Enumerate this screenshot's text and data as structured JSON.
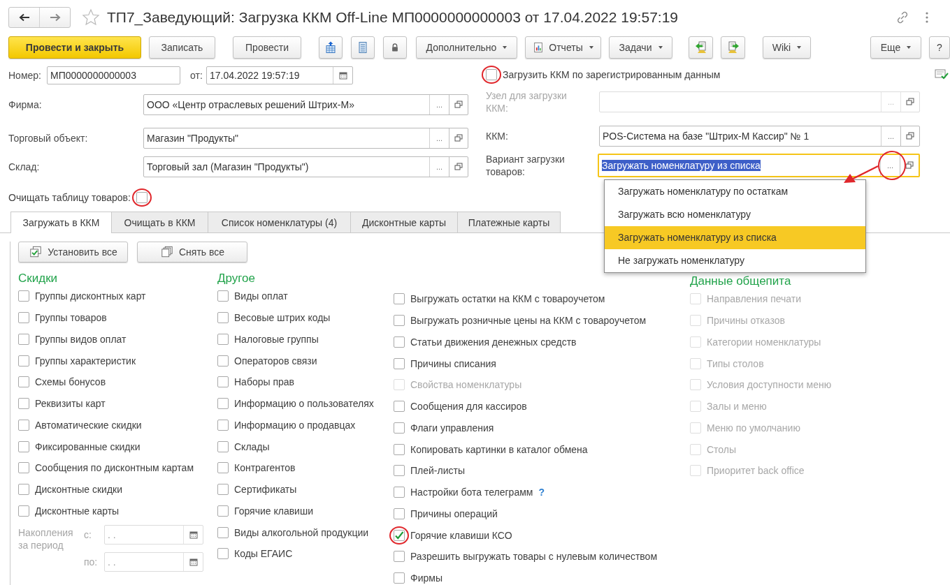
{
  "window": {
    "title": "ТП7_Заведующий: Загрузка ККМ Off-Line МП0000000000003 от 17.04.2022 19:57:19"
  },
  "toolbar": [
    {
      "kind": "primary",
      "label": "Провести и закрыть"
    },
    {
      "kind": "text",
      "label": "Записать"
    },
    {
      "kind": "text",
      "label": "Провести"
    },
    {
      "kind": "icon"
    },
    {
      "kind": "icon"
    },
    {
      "kind": "icon"
    },
    {
      "kind": "menu",
      "label": "Дополнительно"
    },
    {
      "kind": "menu",
      "label": "Отчеты"
    },
    {
      "kind": "menu",
      "label": "Задачи"
    },
    {
      "kind": "icon"
    },
    {
      "kind": "icon"
    },
    {
      "kind": "menu",
      "label": "Wiki"
    },
    {
      "kind": "menu",
      "label": "Еще"
    },
    {
      "kind": "text",
      "label": "?"
    }
  ],
  "number": {
    "label": "Номер:",
    "value": "МП0000000000003"
  },
  "date": {
    "label": "от:",
    "value": "17.04.2022 19:57:19"
  },
  "fields": [
    {
      "label": "Фирма:",
      "value": "ООО «Центр отраслевых решений Штрих-М»",
      "select_button": "..."
    },
    {
      "label": "Торговый объект:",
      "value": "Магазин \"Продукты\"",
      "select_button": "..."
    },
    {
      "label": "Склад:",
      "value": "Торговый зал (Магазин \"Продукты\")",
      "select_button": "..."
    }
  ],
  "clear_table": {
    "label": "Очищать таблицу товаров:",
    "checked": false,
    "highlighted": true
  },
  "load_registered": {
    "label": "Загрузить ККМ по зарегистрированным данным",
    "checked": false,
    "highlighted": true
  },
  "right_fields": [
    {
      "label": "Узел для загрузки ККМ:",
      "select_button": "...",
      "disabled": true,
      "focused": false,
      "text_selected": false,
      "highlighted": false
    },
    {
      "label": "ККМ:",
      "value": "POS-Система на базе \"Штрих-М Кассир\" № 1",
      "select_button": "...",
      "disabled": false,
      "focused": false,
      "text_selected": false,
      "highlighted": false
    },
    {
      "label": "Вариант загрузки товаров:",
      "value": "Загружать номенклатуру из списка",
      "select_button": "...",
      "disabled": false,
      "focused": true,
      "text_selected": true,
      "highlighted": true
    }
  ],
  "dropdown": {
    "options": [
      {
        "label": "Загружать номенклатуру по остаткам",
        "selected": false
      },
      {
        "label": "Загружать всю номенклатуру",
        "selected": false
      },
      {
        "label": "Загружать номенклатуру из списка",
        "selected": true
      },
      {
        "label": "Не загружать номенклатуру",
        "selected": false
      }
    ]
  },
  "tabs": [
    {
      "label": "Загружать в ККМ",
      "selected": true
    },
    {
      "label": "Очищать в ККМ",
      "selected": false
    },
    {
      "label": "Список номенклатуры (4)",
      "selected": false
    },
    {
      "label": "Дисконтные карты",
      "selected": false
    },
    {
      "label": "Платежные карты",
      "selected": false
    }
  ],
  "tab_buttons": [
    {
      "label": "Установить все"
    },
    {
      "label": "Снять все"
    }
  ],
  "groups": [
    {
      "title": "Скидки",
      "items": [
        {
          "label": "Группы дисконтных карт",
          "checked": false,
          "disabled": false,
          "highlighted": false
        },
        {
          "label": "Группы товаров",
          "checked": false,
          "disabled": false,
          "highlighted": false
        },
        {
          "label": "Группы видов оплат",
          "checked": false,
          "disabled": false,
          "highlighted": false
        },
        {
          "label": "Группы характеристик",
          "checked": false,
          "disabled": false,
          "highlighted": false
        },
        {
          "label": "Схемы бонусов",
          "checked": false,
          "disabled": false,
          "highlighted": false
        },
        {
          "label": "Реквизиты карт",
          "checked": false,
          "disabled": false,
          "highlighted": false
        },
        {
          "label": "Автоматические скидки",
          "checked": false,
          "disabled": false,
          "highlighted": false
        },
        {
          "label": "Фиксированные скидки",
          "checked": false,
          "disabled": false,
          "highlighted": false
        },
        {
          "label": "Сообщения по дисконтным картам",
          "checked": false,
          "disabled": false,
          "highlighted": false
        },
        {
          "label": "Дисконтные скидки",
          "checked": false,
          "disabled": false,
          "highlighted": false
        },
        {
          "label": "Дисконтные карты",
          "checked": false,
          "disabled": false,
          "highlighted": false
        }
      ]
    },
    {
      "title": "Другое",
      "items": [
        {
          "label": "Виды оплат",
          "checked": false,
          "disabled": false,
          "highlighted": false
        },
        {
          "label": "Весовые штрих коды",
          "checked": false,
          "disabled": false,
          "highlighted": false
        },
        {
          "label": "Налоговые группы",
          "checked": false,
          "disabled": false,
          "highlighted": false
        },
        {
          "label": "Операторов связи",
          "checked": false,
          "disabled": false,
          "highlighted": false
        },
        {
          "label": "Наборы прав",
          "checked": false,
          "disabled": false,
          "highlighted": false
        },
        {
          "label": "Информацию о пользователях",
          "checked": false,
          "disabled": false,
          "highlighted": false
        },
        {
          "label": "Информацию о продавцах",
          "checked": false,
          "disabled": false,
          "highlighted": false
        },
        {
          "label": "Склады",
          "checked": false,
          "disabled": false,
          "highlighted": false
        },
        {
          "label": "Контрагентов",
          "checked": false,
          "disabled": false,
          "highlighted": false
        },
        {
          "label": "Сертификаты",
          "checked": false,
          "disabled": false,
          "highlighted": false
        },
        {
          "label": "Горячие клавиши",
          "checked": false,
          "disabled": false,
          "highlighted": false
        },
        {
          "label": "Виды алкогольной продукции",
          "checked": false,
          "disabled": false,
          "highlighted": false
        },
        {
          "label": "Коды ЕГАИС",
          "checked": false,
          "disabled": false,
          "highlighted": false
        }
      ]
    },
    {
      "items": [
        {
          "label": "Выгружать остатки на ККМ с товароучетом",
          "checked": false,
          "disabled": false,
          "highlighted": false
        },
        {
          "label": "Выгружать розничные цены на ККМ с товароучетом",
          "checked": false,
          "disabled": false,
          "highlighted": false
        },
        {
          "label": "Статьи движения денежных средств",
          "checked": false,
          "disabled": false,
          "highlighted": false
        },
        {
          "label": "Причины списания",
          "checked": false,
          "disabled": false,
          "highlighted": false
        },
        {
          "label": "Свойства номенклатуры",
          "checked": false,
          "disabled": true,
          "highlighted": false
        },
        {
          "label": "Сообщения для кассиров",
          "checked": false,
          "disabled": false,
          "highlighted": false
        },
        {
          "label": "Флаги управления",
          "checked": false,
          "disabled": false,
          "highlighted": false
        },
        {
          "label": "Копировать картинки в каталог обмена",
          "checked": false,
          "disabled": false,
          "highlighted": false
        },
        {
          "label": "Плей-листы",
          "checked": false,
          "disabled": false,
          "highlighted": false
        },
        {
          "label": "Настройки бота телеграмм",
          "help": "?",
          "checked": false,
          "disabled": false,
          "highlighted": false
        },
        {
          "label": "Причины операций",
          "checked": false,
          "disabled": false,
          "highlighted": false
        },
        {
          "label": "Горячие клавиши КСО",
          "checked": true,
          "disabled": false,
          "highlighted": true
        },
        {
          "label": "Разрешить выгружать товары с нулевым количеством",
          "checked": false,
          "disabled": false,
          "highlighted": false
        },
        {
          "label": "Фирмы",
          "checked": false,
          "disabled": false,
          "highlighted": false
        }
      ]
    },
    {
      "title": "Данные общепита",
      "items": [
        {
          "label": "Направления печати",
          "checked": false,
          "disabled": true,
          "highlighted": false
        },
        {
          "label": "Причины отказов",
          "checked": false,
          "disabled": true,
          "highlighted": false
        },
        {
          "label": "Категории номенклатуры",
          "checked": false,
          "disabled": true,
          "highlighted": false
        },
        {
          "label": "Типы столов",
          "checked": false,
          "disabled": true,
          "highlighted": false
        },
        {
          "label": "Условия доступности меню",
          "checked": false,
          "disabled": true,
          "highlighted": false
        },
        {
          "label": "Залы и меню",
          "checked": false,
          "disabled": true,
          "highlighted": false
        },
        {
          "label": "Меню по умолчанию",
          "checked": false,
          "disabled": true,
          "highlighted": false
        },
        {
          "label": "Столы",
          "checked": false,
          "disabled": true,
          "highlighted": false
        },
        {
          "label": "Приоритет back office",
          "checked": false,
          "disabled": true,
          "highlighted": false
        }
      ]
    }
  ],
  "accumulation": {
    "label": "Накопления за период",
    "from": {
      "label": "с:",
      "placeholder": ". ."
    },
    "to": {
      "label": "по:",
      "placeholder": ". ."
    }
  }
}
